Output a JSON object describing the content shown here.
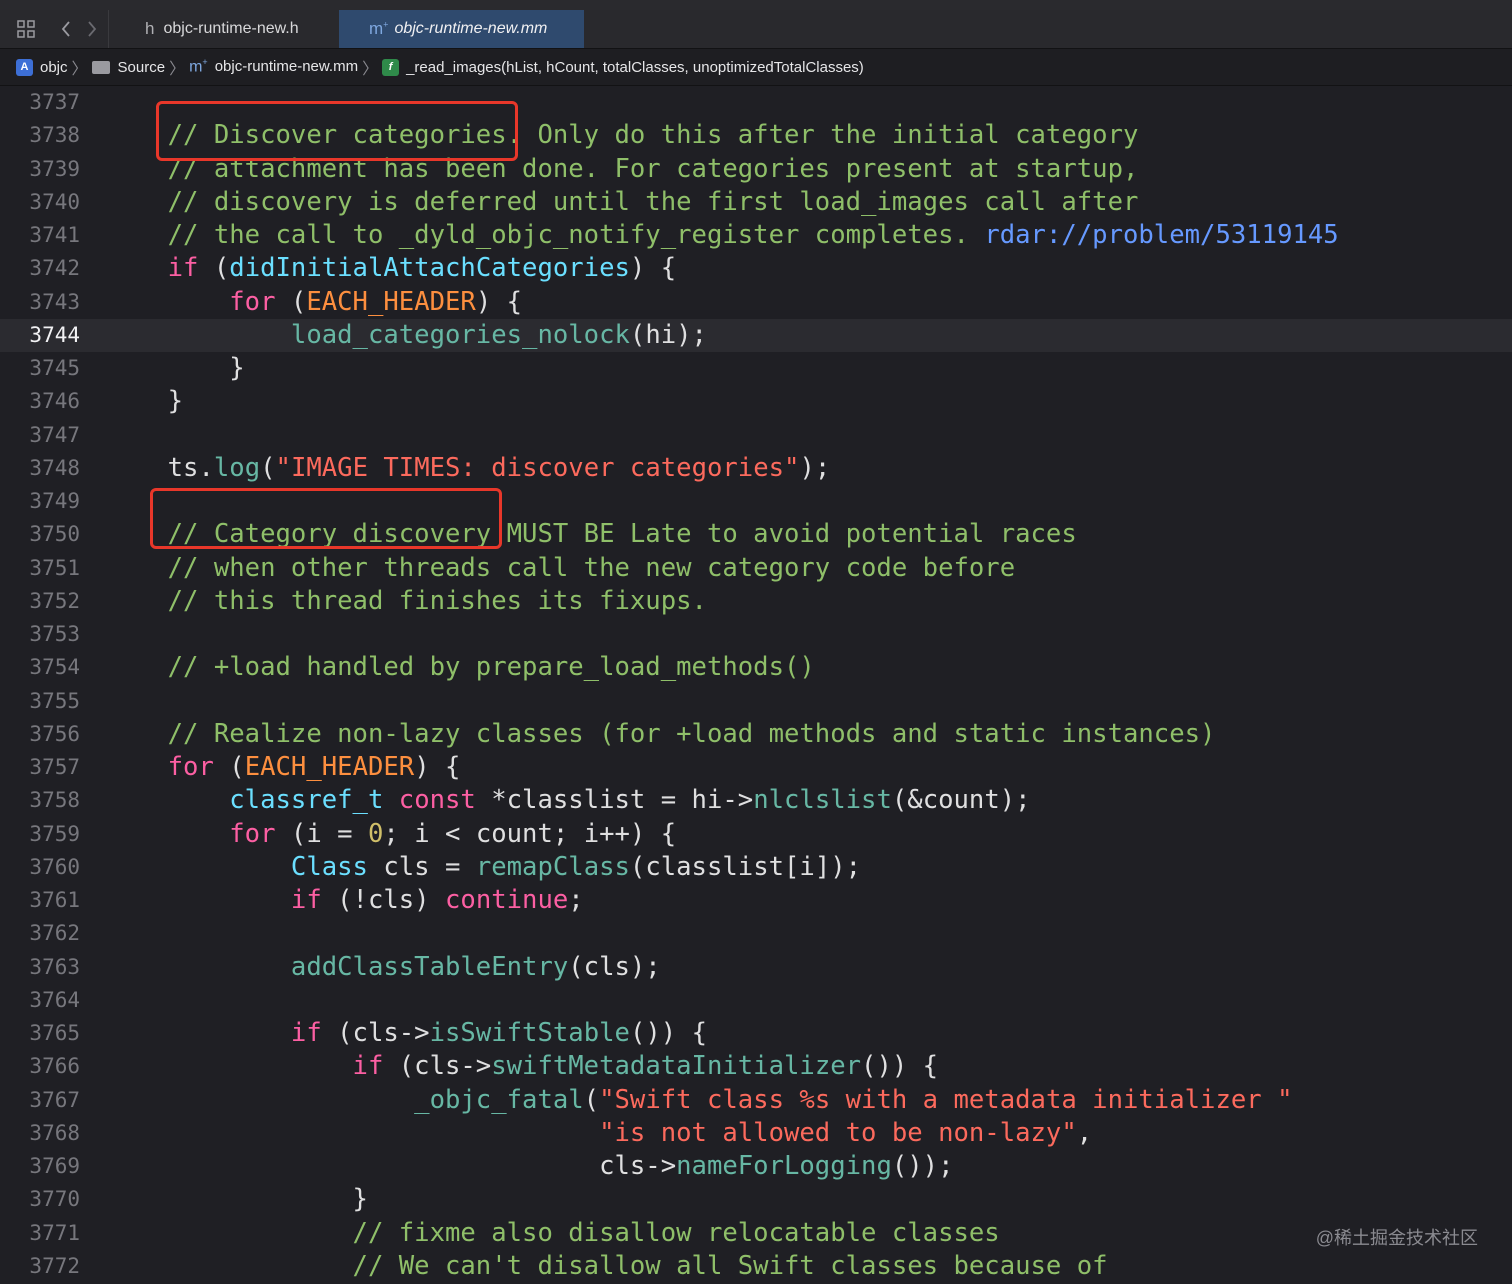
{
  "toolbar": {
    "grid_icon": "grid-icon",
    "back_icon": "chevron-left-icon",
    "forward_icon": "chevron-right-icon"
  },
  "tabs": [
    {
      "label": "objc-runtime-new.h",
      "icon_text": "h",
      "active": false
    },
    {
      "label": "objc-runtime-new.mm",
      "icon_text": "m",
      "active": true
    }
  ],
  "jumpbar": {
    "items": [
      {
        "label": "objc",
        "icon": "project-icon"
      },
      {
        "label": "Source",
        "icon": "folder-icon"
      },
      {
        "label": "objc-runtime-new.mm",
        "icon": "objc-file-icon"
      },
      {
        "label": "_read_images(hList, hCount, totalClasses, unoptimizedTotalClasses)",
        "icon": "function-icon"
      }
    ]
  },
  "editor": {
    "current_line": "3744",
    "lines": [
      {
        "n": "3737",
        "tokens": []
      },
      {
        "n": "3738",
        "tokens": [
          [
            "comment",
            "    // Discover categories. Only do this after the initial category"
          ]
        ]
      },
      {
        "n": "3739",
        "tokens": [
          [
            "comment",
            "    // attachment has been done. For categories present at startup,"
          ]
        ]
      },
      {
        "n": "3740",
        "tokens": [
          [
            "comment",
            "    // discovery is deferred until the first load_images call after"
          ]
        ]
      },
      {
        "n": "3741",
        "tokens": [
          [
            "comment",
            "    // the call to _dyld_objc_notify_register completes. "
          ],
          [
            "link",
            "rdar://problem/53119145"
          ]
        ]
      },
      {
        "n": "3742",
        "tokens": [
          [
            "kw",
            "    if"
          ],
          [
            "plain",
            " ("
          ],
          [
            "type",
            "didInitialAttachCategories"
          ],
          [
            "plain",
            ") {"
          ]
        ]
      },
      {
        "n": "3743",
        "tokens": [
          [
            "kw",
            "        for"
          ],
          [
            "plain",
            " ("
          ],
          [
            "macro",
            "EACH_HEADER"
          ],
          [
            "plain",
            ") {"
          ]
        ]
      },
      {
        "n": "3744",
        "tokens": [
          [
            "fn",
            "            load_categories_nolock"
          ],
          [
            "plain",
            "(hi);"
          ]
        ]
      },
      {
        "n": "3745",
        "tokens": [
          [
            "plain",
            "        }"
          ]
        ]
      },
      {
        "n": "3746",
        "tokens": [
          [
            "plain",
            "    }"
          ]
        ]
      },
      {
        "n": "3747",
        "tokens": []
      },
      {
        "n": "3748",
        "tokens": [
          [
            "plain",
            "    ts."
          ],
          [
            "fn",
            "log"
          ],
          [
            "plain",
            "("
          ],
          [
            "str",
            "\"IMAGE TIMES: discover categories\""
          ],
          [
            "plain",
            ");"
          ]
        ]
      },
      {
        "n": "3749",
        "tokens": []
      },
      {
        "n": "3750",
        "tokens": [
          [
            "comment",
            "    // Category discovery MUST BE Late to avoid potential races"
          ]
        ]
      },
      {
        "n": "3751",
        "tokens": [
          [
            "comment",
            "    // when other threads call the new category code before"
          ]
        ]
      },
      {
        "n": "3752",
        "tokens": [
          [
            "comment",
            "    // this thread finishes its fixups."
          ]
        ]
      },
      {
        "n": "3753",
        "tokens": []
      },
      {
        "n": "3754",
        "tokens": [
          [
            "comment",
            "    // +load handled by prepare_load_methods()"
          ]
        ]
      },
      {
        "n": "3755",
        "tokens": []
      },
      {
        "n": "3756",
        "tokens": [
          [
            "comment",
            "    // Realize non-lazy classes (for +load methods and static instances)"
          ]
        ]
      },
      {
        "n": "3757",
        "tokens": [
          [
            "kw",
            "    for"
          ],
          [
            "plain",
            " ("
          ],
          [
            "macro",
            "EACH_HEADER"
          ],
          [
            "plain",
            ") {"
          ]
        ]
      },
      {
        "n": "3758",
        "tokens": [
          [
            "type",
            "        classref_t"
          ],
          [
            "plain",
            " "
          ],
          [
            "kw",
            "const"
          ],
          [
            "plain",
            " *classlist = hi->"
          ],
          [
            "fn",
            "nlclslist"
          ],
          [
            "plain",
            "(&count);"
          ]
        ]
      },
      {
        "n": "3759",
        "tokens": [
          [
            "kw",
            "        for"
          ],
          [
            "plain",
            " (i = "
          ],
          [
            "num",
            "0"
          ],
          [
            "plain",
            "; i < count; i++) {"
          ]
        ]
      },
      {
        "n": "3760",
        "tokens": [
          [
            "type",
            "            Class"
          ],
          [
            "plain",
            " cls = "
          ],
          [
            "fn",
            "remapClass"
          ],
          [
            "plain",
            "(classlist[i]);"
          ]
        ]
      },
      {
        "n": "3761",
        "tokens": [
          [
            "kw",
            "            if"
          ],
          [
            "plain",
            " (!cls) "
          ],
          [
            "kw",
            "continue"
          ],
          [
            "plain",
            ";"
          ]
        ]
      },
      {
        "n": "3762",
        "tokens": []
      },
      {
        "n": "3763",
        "tokens": [
          [
            "fn",
            "            addClassTableEntry"
          ],
          [
            "plain",
            "(cls);"
          ]
        ]
      },
      {
        "n": "3764",
        "tokens": []
      },
      {
        "n": "3765",
        "tokens": [
          [
            "kw",
            "            if"
          ],
          [
            "plain",
            " (cls->"
          ],
          [
            "fn",
            "isSwiftStable"
          ],
          [
            "plain",
            "()) {"
          ]
        ]
      },
      {
        "n": "3766",
        "tokens": [
          [
            "kw",
            "                if"
          ],
          [
            "plain",
            " (cls->"
          ],
          [
            "fn",
            "swiftMetadataInitializer"
          ],
          [
            "plain",
            "()) {"
          ]
        ]
      },
      {
        "n": "3767",
        "tokens": [
          [
            "fn",
            "                    _objc_fatal"
          ],
          [
            "plain",
            "("
          ],
          [
            "str",
            "\"Swift class %s with a metadata initializer \""
          ]
        ]
      },
      {
        "n": "3768",
        "tokens": [
          [
            "str",
            "                                \"is not allowed to be non-lazy\""
          ],
          [
            "plain",
            ","
          ]
        ]
      },
      {
        "n": "3769",
        "tokens": [
          [
            "plain",
            "                                cls->"
          ],
          [
            "fn",
            "nameForLogging"
          ],
          [
            "plain",
            "());"
          ]
        ]
      },
      {
        "n": "3770",
        "tokens": [
          [
            "plain",
            "                }"
          ]
        ]
      },
      {
        "n": "3771",
        "tokens": [
          [
            "comment",
            "                // fixme also disallow relocatable classes"
          ]
        ]
      },
      {
        "n": "3772",
        "tokens": [
          [
            "comment",
            "                // We can't disallow all Swift classes because of"
          ]
        ]
      }
    ]
  },
  "annotations": {
    "box_color": "#e8372a"
  },
  "watermark": "@稀土掘金技术社区",
  "colors": {
    "background": "#1f1f24",
    "comment": "#8fbf69",
    "keyword": "#fc5fa3",
    "string": "#fc6a5d",
    "number": "#d0bf69",
    "macro": "#fd8f3f",
    "function": "#67b7a4",
    "type": "#6bdfff",
    "link": "#6699ff",
    "active_tab": "#2f4a6e"
  }
}
